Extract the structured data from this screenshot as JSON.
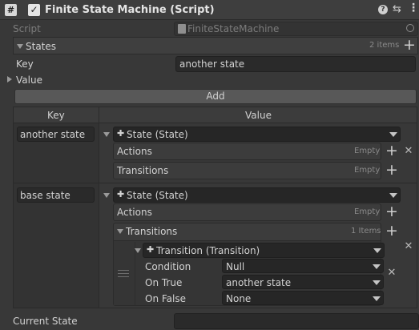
{
  "component": {
    "title": "Finite State Machine (Script)",
    "icon": "hash-icon",
    "enabled": true,
    "script_label": "Script",
    "script_value": "FiniteStateMachine"
  },
  "states": {
    "label": "States",
    "count": "2 items",
    "key_label": "Key",
    "key_value": "another state",
    "value_label": "Value",
    "add_label": "Add"
  },
  "table": {
    "key_header": "Key",
    "value_header": "Value",
    "rows": [
      {
        "key": "another state",
        "type": "State (State)",
        "actions_label": "Actions",
        "actions_count": "Empty",
        "transitions_label": "Transitions",
        "transitions_count": "Empty"
      },
      {
        "key": "base state",
        "type": "State (State)",
        "actions_label": "Actions",
        "actions_count": "Empty",
        "transitions_label": "Transitions",
        "transitions_count": "1 Items",
        "transition": {
          "type": "Transition (Transition)",
          "condition_label": "Condition",
          "condition_value": "Null",
          "on_true_label": "On True",
          "on_true_value": "another state",
          "on_false_label": "On False",
          "on_false_value": "None"
        }
      }
    ]
  },
  "current_state": {
    "label": "Current State",
    "value": ""
  },
  "colors": {
    "background": "#383838",
    "header": "#3e3e3e",
    "field": "#2a2a2a",
    "border": "#212121"
  }
}
